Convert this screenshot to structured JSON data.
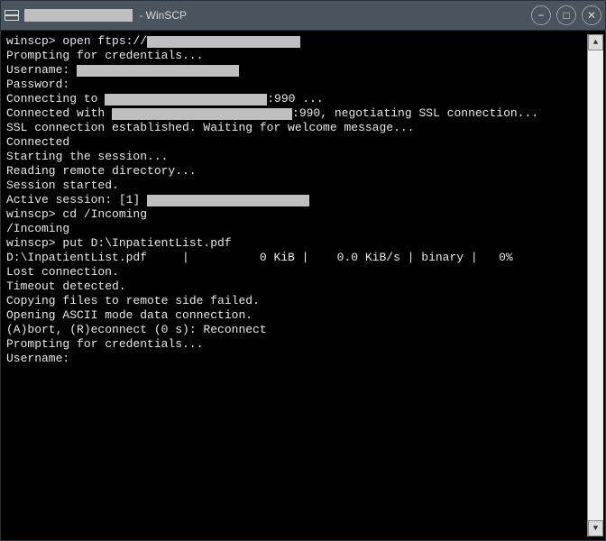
{
  "titlebar": {
    "suffix": " - WinSCP",
    "minimize_label": "−",
    "maximize_label": "□",
    "close_label": "✕"
  },
  "scrollbar": {
    "up": "▲",
    "down": "▼"
  },
  "terminal": {
    "lines": [
      {
        "segments": [
          {
            "t": "winscp> open ftps://"
          },
          {
            "redact": 170
          }
        ]
      },
      {
        "segments": [
          {
            "t": "Prompting for credentials..."
          }
        ]
      },
      {
        "segments": [
          {
            "t": "Username: "
          },
          {
            "redact": 180
          }
        ]
      },
      {
        "segments": [
          {
            "t": "Password:"
          }
        ]
      },
      {
        "segments": [
          {
            "t": "Connecting to "
          },
          {
            "redact": 180
          },
          {
            "t": ":990 ..."
          }
        ]
      },
      {
        "segments": [
          {
            "t": "Connected with "
          },
          {
            "redact": 200
          },
          {
            "t": ":990, negotiating SSL connection..."
          }
        ]
      },
      {
        "segments": [
          {
            "t": "SSL connection established. Waiting for welcome message..."
          }
        ]
      },
      {
        "segments": [
          {
            "t": "Connected"
          }
        ]
      },
      {
        "segments": [
          {
            "t": "Starting the session..."
          }
        ]
      },
      {
        "segments": [
          {
            "t": "Reading remote directory..."
          }
        ]
      },
      {
        "segments": [
          {
            "t": "Session started."
          }
        ]
      },
      {
        "segments": [
          {
            "t": "Active session: [1] "
          },
          {
            "redact": 180
          }
        ]
      },
      {
        "segments": [
          {
            "t": "winscp> cd /Incoming"
          }
        ]
      },
      {
        "segments": [
          {
            "t": "/Incoming"
          }
        ]
      },
      {
        "segments": [
          {
            "t": "winscp> put D:\\InpatientList.pdf"
          }
        ]
      },
      {
        "segments": [
          {
            "t": "D:\\InpatientList.pdf     |          0 KiB |    0.0 KiB/s | binary |   0%"
          }
        ]
      },
      {
        "segments": [
          {
            "t": "Lost connection."
          }
        ]
      },
      {
        "segments": [
          {
            "t": "Timeout detected."
          }
        ]
      },
      {
        "segments": [
          {
            "t": "Copying files to remote side failed."
          }
        ]
      },
      {
        "segments": [
          {
            "t": "Opening ASCII mode data connection."
          }
        ]
      },
      {
        "segments": [
          {
            "t": "(A)bort, (R)econnect (0 s): Reconnect"
          }
        ]
      },
      {
        "segments": [
          {
            "t": "Prompting for credentials..."
          }
        ]
      },
      {
        "segments": [
          {
            "t": "Username:"
          }
        ]
      }
    ]
  }
}
